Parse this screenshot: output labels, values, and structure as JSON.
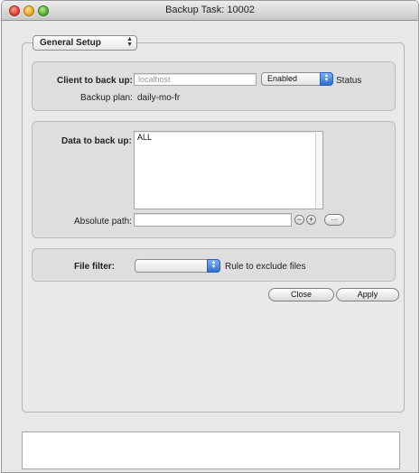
{
  "window": {
    "title": "Backup Task: 10002"
  },
  "tab": {
    "label": "General Setup"
  },
  "client": {
    "label": "Client to back up:",
    "placeholder": "localhost",
    "state_value": "Enabled",
    "status_label": "Status",
    "plan_label": "Backup plan:",
    "plan_value": "daily-mo-fr"
  },
  "data": {
    "label": "Data to back up:",
    "items": [
      "ALL"
    ],
    "path_label": "Absolute path:",
    "path_value": "",
    "remove_label": "−",
    "add_label": "+",
    "browse_label": "..."
  },
  "filter": {
    "label": "File filter:",
    "value": "",
    "hint": "Rule to exclude files"
  },
  "buttons": {
    "close": "Close",
    "apply": "Apply"
  },
  "icons": {
    "close_window": "close-window-icon",
    "minimize": "minimize-icon",
    "zoom": "zoom-icon",
    "popup_arrows": "up-down-arrows-icon"
  }
}
